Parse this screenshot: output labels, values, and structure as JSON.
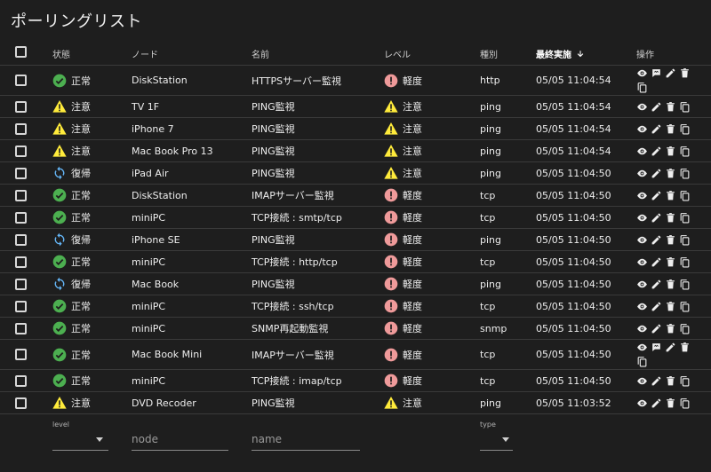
{
  "title": "ポーリングリスト",
  "columns": {
    "state": "状態",
    "node": "ノード",
    "name": "名前",
    "level": "レベル",
    "type": "種別",
    "last_run": "最終実施",
    "ops": "操作"
  },
  "rows": [
    {
      "state_icon": "check-circle-icon",
      "state": "正常",
      "node": "DiskStation",
      "name": "HTTPSサーバー監視",
      "level_icon": "error-circle-icon",
      "level": "軽度",
      "type": "http",
      "time": "05/05 11:04:54",
      "tall": true
    },
    {
      "state_icon": "warning-icon",
      "state": "注意",
      "node": "TV 1F",
      "name": "PING監視",
      "level_icon": "warning-icon",
      "level": "注意",
      "type": "ping",
      "time": "05/05 11:04:54",
      "tall": false
    },
    {
      "state_icon": "warning-icon",
      "state": "注意",
      "node": "iPhone 7",
      "name": "PING監視",
      "level_icon": "warning-icon",
      "level": "注意",
      "type": "ping",
      "time": "05/05 11:04:54",
      "tall": false
    },
    {
      "state_icon": "warning-icon",
      "state": "注意",
      "node": "Mac Book Pro 13",
      "name": "PING監視",
      "level_icon": "warning-icon",
      "level": "注意",
      "type": "ping",
      "time": "05/05 11:04:54",
      "tall": false
    },
    {
      "state_icon": "sync-icon",
      "state": "復帰",
      "node": "iPad Air",
      "name": "PING監視",
      "level_icon": "warning-icon",
      "level": "注意",
      "type": "ping",
      "time": "05/05 11:04:50",
      "tall": false
    },
    {
      "state_icon": "check-circle-icon",
      "state": "正常",
      "node": "DiskStation",
      "name": "IMAPサーバー監視",
      "level_icon": "error-circle-icon",
      "level": "軽度",
      "type": "tcp",
      "time": "05/05 11:04:50",
      "tall": false
    },
    {
      "state_icon": "check-circle-icon",
      "state": "正常",
      "node": "miniPC",
      "name": "TCP接続 : smtp/tcp",
      "level_icon": "error-circle-icon",
      "level": "軽度",
      "type": "tcp",
      "time": "05/05 11:04:50",
      "tall": false
    },
    {
      "state_icon": "sync-icon",
      "state": "復帰",
      "node": "iPhone SE",
      "name": "PING監視",
      "level_icon": "error-circle-icon",
      "level": "軽度",
      "type": "ping",
      "time": "05/05 11:04:50",
      "tall": false
    },
    {
      "state_icon": "check-circle-icon",
      "state": "正常",
      "node": "miniPC",
      "name": "TCP接続 : http/tcp",
      "level_icon": "error-circle-icon",
      "level": "軽度",
      "type": "tcp",
      "time": "05/05 11:04:50",
      "tall": false
    },
    {
      "state_icon": "sync-icon",
      "state": "復帰",
      "node": "Mac Book",
      "name": "PING監視",
      "level_icon": "error-circle-icon",
      "level": "軽度",
      "type": "ping",
      "time": "05/05 11:04:50",
      "tall": false
    },
    {
      "state_icon": "check-circle-icon",
      "state": "正常",
      "node": "miniPC",
      "name": "TCP接続 : ssh/tcp",
      "level_icon": "error-circle-icon",
      "level": "軽度",
      "type": "tcp",
      "time": "05/05 11:04:50",
      "tall": false
    },
    {
      "state_icon": "check-circle-icon",
      "state": "正常",
      "node": "miniPC",
      "name": "SNMP再起動監視",
      "level_icon": "error-circle-icon",
      "level": "軽度",
      "type": "snmp",
      "time": "05/05 11:04:50",
      "tall": false
    },
    {
      "state_icon": "check-circle-icon",
      "state": "正常",
      "node": "Mac Book Mini",
      "name": "IMAPサーバー監視",
      "level_icon": "error-circle-icon",
      "level": "軽度",
      "type": "tcp",
      "time": "05/05 11:04:50",
      "tall": true
    },
    {
      "state_icon": "check-circle-icon",
      "state": "正常",
      "node": "miniPC",
      "name": "TCP接続 : imap/tcp",
      "level_icon": "error-circle-icon",
      "level": "軽度",
      "type": "tcp",
      "time": "05/05 11:04:50",
      "tall": false
    },
    {
      "state_icon": "warning-icon",
      "state": "注意",
      "node": "DVD Recoder",
      "name": "PING監視",
      "level_icon": "warning-icon",
      "level": "注意",
      "type": "ping",
      "time": "05/05 11:03:52",
      "tall": false
    }
  ],
  "filters": {
    "level_label": "level",
    "node_placeholder": "node",
    "name_placeholder": "name",
    "type_label": "type"
  },
  "colors": {
    "ok": "#4caf50",
    "warn": "#ffeb3b",
    "error": "#ef9a9a",
    "sync": "#64b5f6"
  }
}
